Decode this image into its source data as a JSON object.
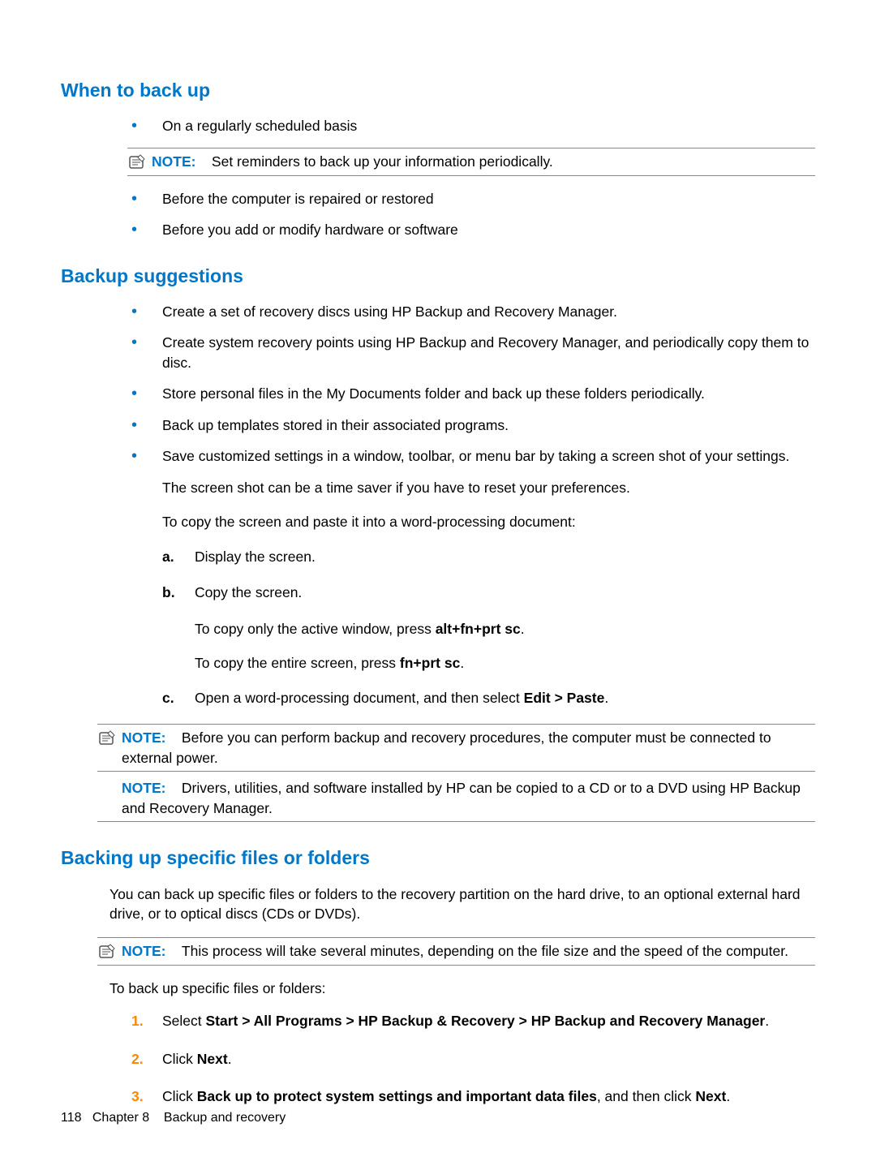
{
  "sections": {
    "when_to_back_up": {
      "heading": "When to back up",
      "items": [
        "On a regularly scheduled basis",
        "Before the computer is repaired or restored",
        "Before you add or modify hardware or software"
      ],
      "note_label": "NOTE:",
      "note_text": "Set reminders to back up your information periodically."
    },
    "backup_suggestions": {
      "heading": "Backup suggestions",
      "items": [
        "Create a set of recovery discs using HP Backup and Recovery Manager.",
        "Create system recovery points using HP Backup and Recovery Manager, and periodically copy them to disc.",
        "Store personal files in the My Documents folder and back up these folders periodically.",
        "Back up templates stored in their associated programs.",
        "Save customized settings in a window, toolbar, or menu bar by taking a screen shot of your settings."
      ],
      "para1": "The screen shot can be a time saver if you have to reset your preferences.",
      "para2": "To copy the screen and paste it into a word-processing document:",
      "steps": {
        "a": "Display the screen.",
        "b": "Copy the screen.",
        "c_pre": "Open a word-processing document, and then select ",
        "c_bold": "Edit > Paste",
        "c_post": "."
      },
      "sub1_pre": "To copy only the active window, press ",
      "sub1_bold": "alt+fn+prt sc",
      "sub1_post": ".",
      "sub2_pre": "To copy the entire screen, press ",
      "sub2_bold": "fn+prt sc",
      "sub2_post": ".",
      "note1_label": "NOTE:",
      "note1_text": "Before you can perform backup and recovery procedures, the computer must be connected to external power.",
      "note2_label": "NOTE:",
      "note2_text": "Drivers, utilities, and software installed by HP can be copied to a CD or to a DVD using HP Backup and Recovery Manager."
    },
    "backing_up_files": {
      "heading": "Backing up specific files or folders",
      "intro": "You can back up specific files or folders to the recovery partition on the hard drive, to an optional external hard drive, or to optical discs (CDs or DVDs).",
      "note_label": "NOTE:",
      "note_text": "This process will take several minutes, depending on the file size and the speed of the computer.",
      "para": "To back up specific files or folders:",
      "step1_pre": "Select ",
      "step1_bold": "Start > All Programs > HP Backup & Recovery > HP Backup and Recovery Manager",
      "step1_post": ".",
      "step2_pre": "Click ",
      "step2_bold": "Next",
      "step2_post": ".",
      "step3_pre": "Click ",
      "step3_bold1": "Back up to protect system settings and important data files",
      "step3_mid": ", and then click ",
      "step3_bold2": "Next",
      "step3_post": "."
    }
  },
  "footer": {
    "page": "118",
    "chapter_label": "Chapter 8",
    "chapter_title": "Backup and recovery"
  },
  "icon_char": "✎"
}
